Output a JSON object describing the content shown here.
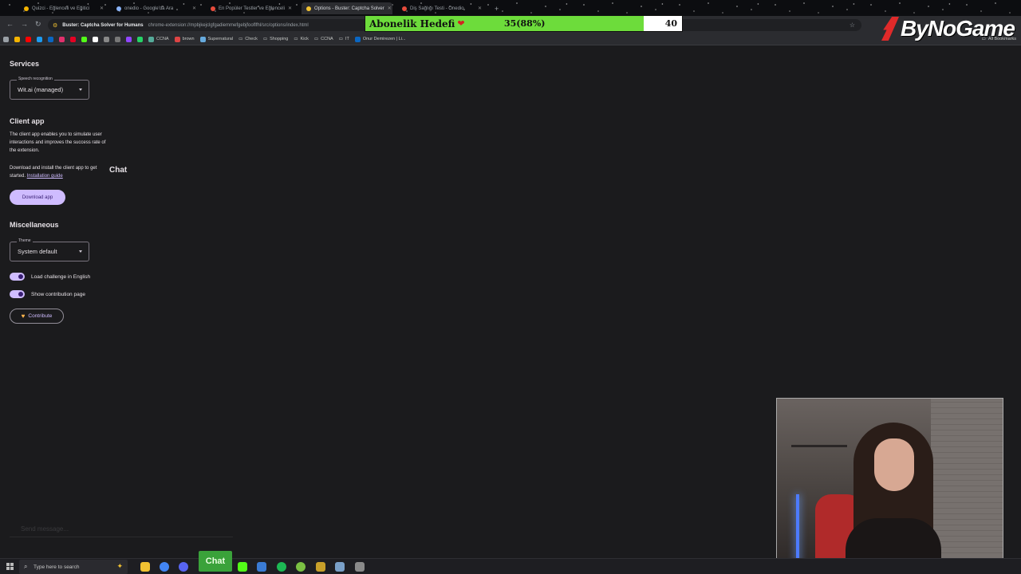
{
  "browser": {
    "tabs": [
      {
        "title": "Quizci - Eğlenceli ve Eğitici"
      },
      {
        "title": "onedio - Google'da Ara"
      },
      {
        "title": "En Popüler Testler ve Eğlenceli"
      },
      {
        "title": "Options - Buster: Captcha Solver"
      },
      {
        "title": "Diş Sağlığı Testi - Onedio"
      }
    ],
    "site_name": "Buster: Captcha Solver for Humans",
    "url": "chrome-extension://mpbjkejclgfgadiemmefgebjfooflfhl/src/options/index.html",
    "bookmarks": [
      "CCNA",
      "brown",
      "Supernatural",
      "Check",
      "Shopping",
      "Kick",
      "CCNA",
      "IT",
      "Onur Demirezen | Li..."
    ],
    "all_bookmarks": "All Bookmarks"
  },
  "overlay": {
    "goal_label": "Abonelik Hedefi",
    "goal_value": "35(88%)",
    "goal_target": "40",
    "goal_progress": 0.88,
    "brand": "ByNoGame",
    "chat_label": "Chat",
    "send_message_placeholder": "Send message..."
  },
  "options": {
    "services_heading": "Services",
    "speech_label": "Speech recognition",
    "speech_value": "Wit.ai (managed)",
    "client_heading": "Client app",
    "client_desc": "The client app enables you to simulate user interactions and improves the success rate of the extension.",
    "client_install_text": "Download and install the client app to get started.",
    "install_link": "Installation guide",
    "download_button": "Download app",
    "misc_heading": "Miscellaneous",
    "theme_label": "Theme",
    "theme_value": "System default",
    "toggle_english": "Load challenge in English",
    "toggle_contrib": "Show contribution page",
    "contribute_button": "Contribute"
  },
  "taskbar": {
    "search_placeholder": "Type here to search",
    "chat_button": "Chat"
  }
}
